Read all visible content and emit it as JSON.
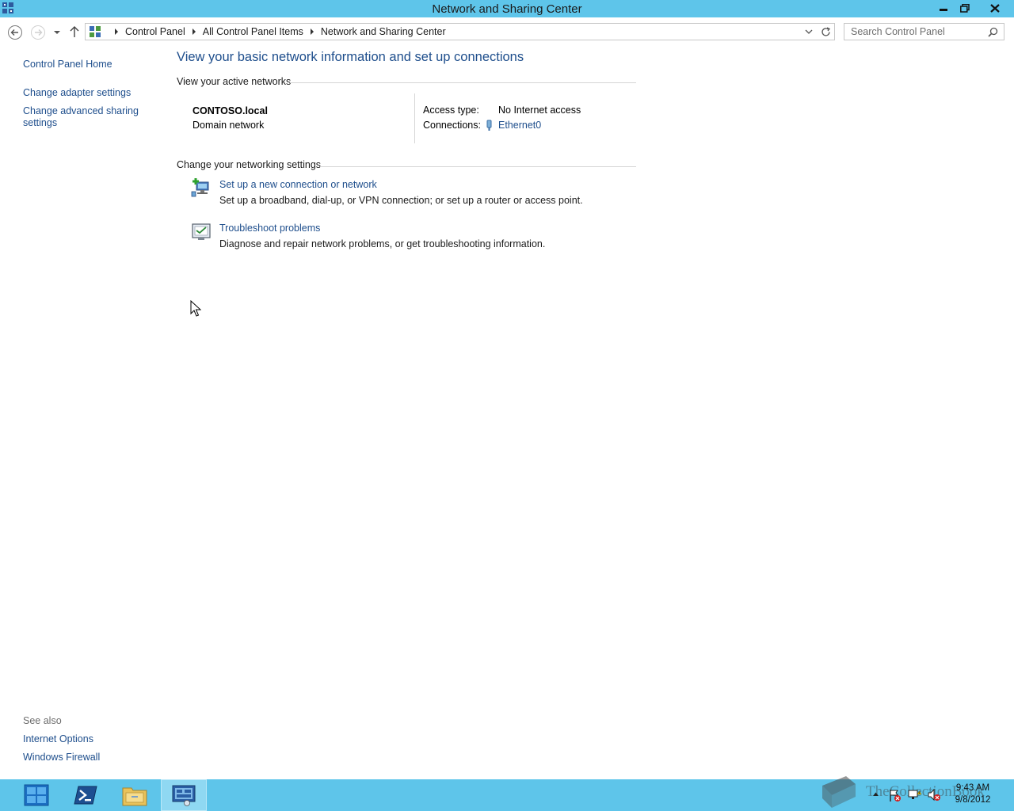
{
  "window": {
    "title": "Network and Sharing Center"
  },
  "address_bar": {
    "breadcrumbs": [
      "Control Panel",
      "All Control Panel Items",
      "Network and Sharing Center"
    ]
  },
  "search": {
    "placeholder": "Search Control Panel"
  },
  "left_pane": {
    "home": "Control Panel Home",
    "adapter": "Change adapter settings",
    "advanced": "Change advanced sharing settings",
    "see_also_heading": "See also",
    "see_also": [
      "Internet Options",
      "Windows Firewall"
    ]
  },
  "main": {
    "title": "View your basic network information and set up connections",
    "active_networks_heading": "View your active networks",
    "network": {
      "name": "CONTOSO.local",
      "category": "Domain network",
      "access_type_label": "Access type:",
      "access_type_value": "No Internet access",
      "connections_label": "Connections:",
      "connection_name": "Ethernet0"
    },
    "change_settings_heading": "Change your networking settings",
    "tasks": [
      {
        "title": "Set up a new connection or network",
        "description": "Set up a broadband, dial-up, or VPN connection; or set up a router or access point.",
        "icon": "network-setup-icon"
      },
      {
        "title": "Troubleshoot problems",
        "description": "Diagnose and repair network problems, or get troubleshooting information.",
        "icon": "troubleshoot-icon"
      }
    ]
  },
  "taskbar": {
    "items": [
      "start-icon",
      "powershell-icon",
      "file-explorer-icon",
      "control-panel-icon"
    ],
    "time": "9:43 AM",
    "date": "9/8/2012",
    "watermark": "TheCollectionBook"
  },
  "colors": {
    "titlebar": "#5ec5ea",
    "link": "#1e4e8c",
    "taskbar": "#5ec5ea"
  }
}
